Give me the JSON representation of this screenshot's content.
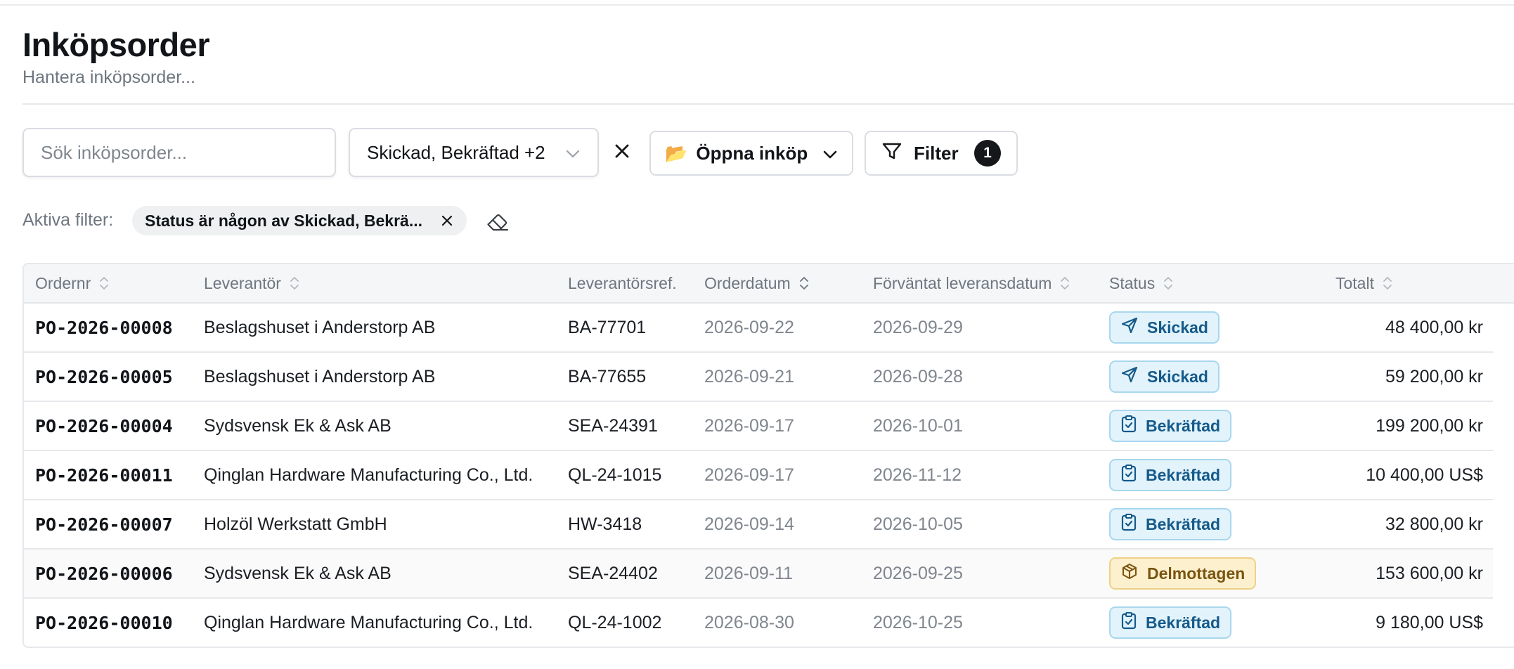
{
  "header": {
    "title": "Inköpsorder",
    "subtitle": "Hantera inköpsorder..."
  },
  "toolbar": {
    "search_placeholder": "Sök inköpsorder...",
    "status_select_value": "Skickad, Bekräftad +2",
    "open_purchases_label": "Öppna inköp",
    "filter_label": "Filter",
    "filter_count": "1"
  },
  "active_filters": {
    "label": "Aktiva filter:",
    "chips": [
      "Status är någon av Skickad, Bekrä..."
    ]
  },
  "table": {
    "columns": [
      "Ordernr",
      "Leverantör",
      "Leverantörsref.",
      "Orderdatum",
      "Förväntat leveransdatum",
      "Status",
      "Totalt"
    ],
    "rows": [
      {
        "order": "PO-2026-00008",
        "supplier": "Beslagshuset i Anderstorp AB",
        "ref": "BA-77701",
        "order_date": "2026-09-22",
        "expected": "2026-09-29",
        "status": "Skickad",
        "status_type": "sent",
        "total": "48 400,00 kr"
      },
      {
        "order": "PO-2026-00005",
        "supplier": "Beslagshuset i Anderstorp AB",
        "ref": "BA-77655",
        "order_date": "2026-09-21",
        "expected": "2026-09-28",
        "status": "Skickad",
        "status_type": "sent",
        "total": "59 200,00 kr"
      },
      {
        "order": "PO-2026-00004",
        "supplier": "Sydsvensk Ek & Ask AB",
        "ref": "SEA-24391",
        "order_date": "2026-09-17",
        "expected": "2026-10-01",
        "status": "Bekräftad",
        "status_type": "confirmed",
        "total": "199 200,00 kr"
      },
      {
        "order": "PO-2026-00011",
        "supplier": "Qinglan Hardware Manufacturing Co., Ltd.",
        "ref": "QL-24-1015",
        "order_date": "2026-09-17",
        "expected": "2026-11-12",
        "status": "Bekräftad",
        "status_type": "confirmed",
        "total": "10 400,00 US$"
      },
      {
        "order": "PO-2026-00007",
        "supplier": "Holzöl Werkstatt GmbH",
        "ref": "HW-3418",
        "order_date": "2026-09-14",
        "expected": "2026-10-05",
        "status": "Bekräftad",
        "status_type": "confirmed",
        "total": "32 800,00 kr"
      },
      {
        "order": "PO-2026-00006",
        "supplier": "Sydsvensk Ek & Ask AB",
        "ref": "SEA-24402",
        "order_date": "2026-09-11",
        "expected": "2026-09-25",
        "status": "Delmottagen",
        "status_type": "partial",
        "total": "153 600,00 kr"
      },
      {
        "order": "PO-2026-00010",
        "supplier": "Qinglan Hardware Manufacturing Co., Ltd.",
        "ref": "QL-24-1002",
        "order_date": "2026-08-30",
        "expected": "2026-10-25",
        "status": "Bekräftad",
        "status_type": "confirmed",
        "total": "9 180,00 US$"
      }
    ]
  },
  "icons": {
    "sent": "paper-plane-icon",
    "confirmed": "clipboard-check-icon",
    "partial": "package-icon",
    "open_purchases": "open-folder-icon",
    "filter": "funnel-icon",
    "clear": "close-icon",
    "clear_all": "eraser-icon",
    "sort": "sort-icon"
  },
  "colors": {
    "status_sent_bg": "#e2f3fb",
    "status_sent_text": "#155a8a",
    "status_partial_bg": "#fdf0cf",
    "status_partial_text": "#7a5510",
    "badge_bg": "#15171a"
  }
}
